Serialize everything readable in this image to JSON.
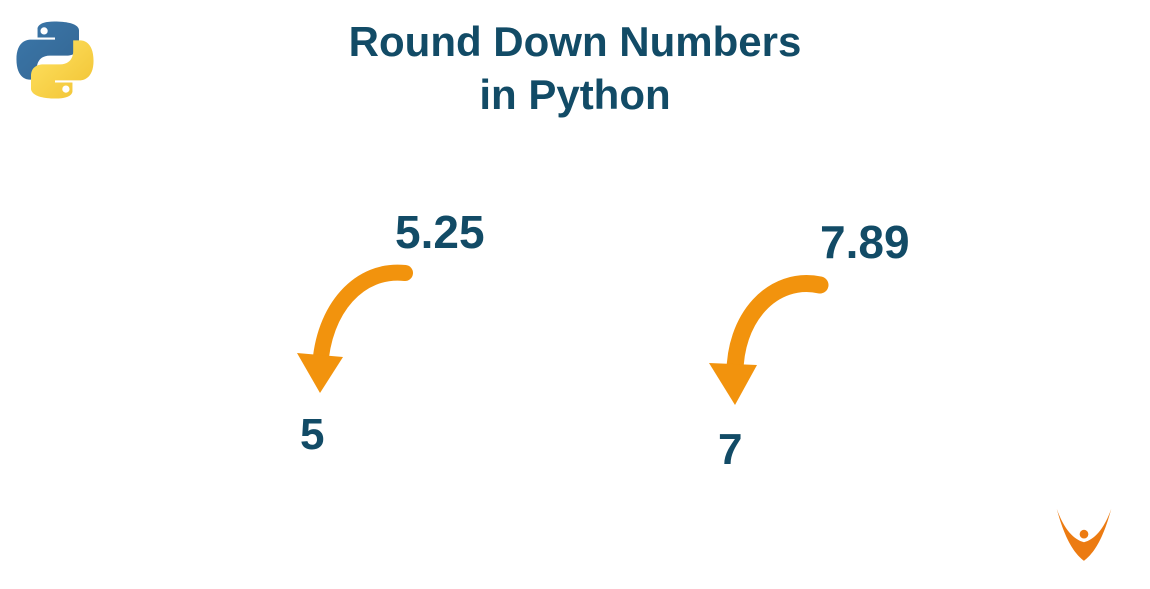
{
  "title_line1": "Round Down Numbers",
  "title_line2": "in Python",
  "examples": [
    {
      "input": "5.25",
      "output": "5"
    },
    {
      "input": "7.89",
      "output": "7"
    }
  ],
  "colors": {
    "text": "#124b66",
    "arrow": "#f2930d",
    "python_blue": "#366b98",
    "python_yellow": "#f5c93b",
    "brand": "#ec7b12"
  },
  "icons": {
    "top_left": "python-logo-icon",
    "arrow": "curved-down-arrow-icon",
    "brand": "person-arms-up-icon"
  }
}
